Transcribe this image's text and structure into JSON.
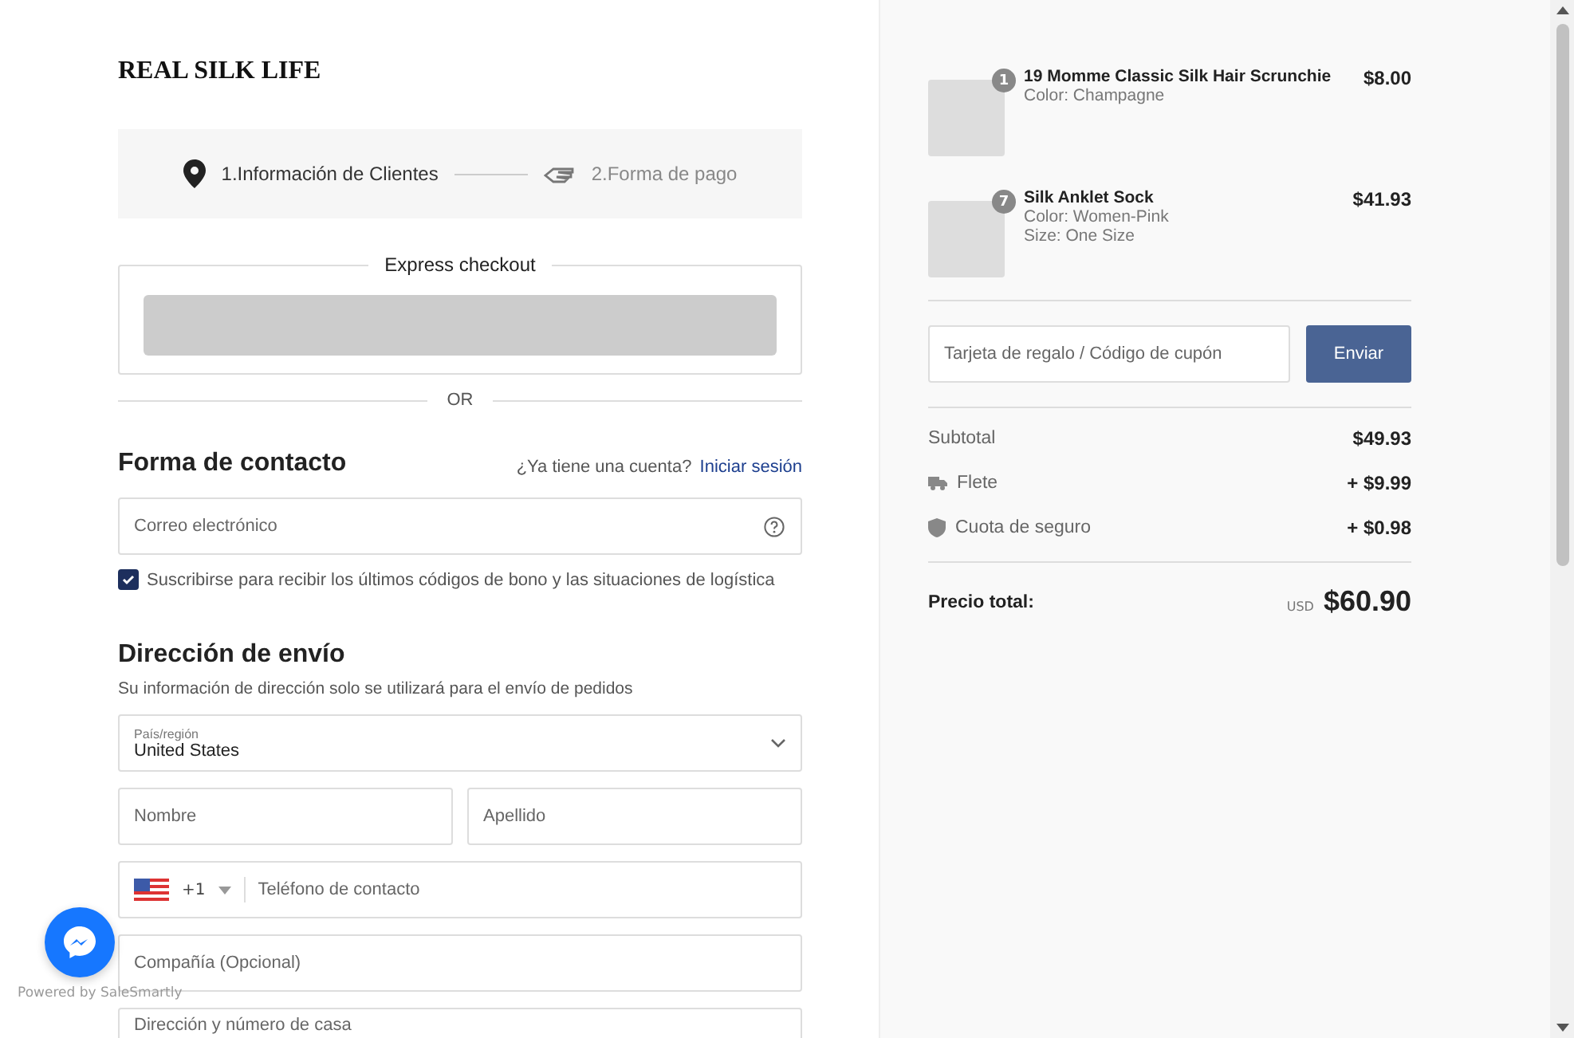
{
  "store": {
    "name": "REAL SILK LIFE"
  },
  "steps": [
    {
      "label": "1.Información de Clientes",
      "selected": true
    },
    {
      "label": "2.Forma de pago",
      "selected": false
    }
  ],
  "express_checkout": {
    "title": "Express checkout"
  },
  "divider_label": "OR",
  "contact": {
    "title": "Forma de contacto",
    "account_prompt": "¿Ya tiene una cuenta?",
    "login_link": "Iniciar sesión",
    "email": {
      "placeholder": "Correo electrónico"
    },
    "subscribe": {
      "label": "Suscribirse para recibir los últimos códigos de bono y las situaciones de logística",
      "checked": true
    }
  },
  "shipping": {
    "title": "Dirección de envío",
    "note": "Su información de dirección solo se utilizará para el envío de pedidos",
    "country": {
      "label": "País/región",
      "value": "United States"
    },
    "first_name": {
      "placeholder": "Nombre"
    },
    "last_name": {
      "placeholder": "Apellido"
    },
    "phone": {
      "code": "+1",
      "placeholder": "Teléfono de contacto"
    },
    "company": {
      "placeholder": "Compañía (Opcional)"
    },
    "address": {
      "placeholder": "Dirección y número de casa"
    }
  },
  "chat_widget": {
    "caption": "Powered by SaleSmartly"
  },
  "order": {
    "items": [
      {
        "name": "19 Momme Classic Silk Hair Scrunchie",
        "quantity": "1",
        "details": [
          "Color: Champagne"
        ],
        "price": "$8.00"
      },
      {
        "name": "Silk Anklet Sock",
        "quantity": "7",
        "details": [
          "Color: Women-Pink",
          "Size: One Size"
        ],
        "price": "$41.93"
      }
    ],
    "coupon": {
      "placeholder": "Tarjeta de regalo / Código de cupón",
      "button": "Enviar"
    },
    "lines": [
      {
        "kind": "plain",
        "label": "Subtotal",
        "value": "$49.93"
      },
      {
        "kind": "shipping",
        "label": "Flete",
        "value": "+ $9.99"
      },
      {
        "kind": "insurance",
        "label": "Cuota de seguro",
        "value": "+ $0.98"
      }
    ],
    "total": {
      "label": "Precio total:",
      "currency": "USD",
      "value": "$60.90"
    }
  }
}
